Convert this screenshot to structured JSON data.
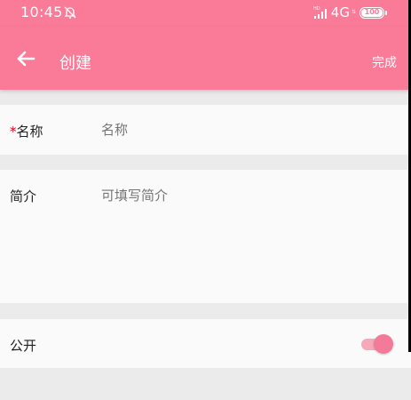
{
  "status_bar": {
    "time": "10:45",
    "network": "4G",
    "battery": "100"
  },
  "app_bar": {
    "title": "创建",
    "done_label": "完成"
  },
  "form": {
    "name": {
      "required_mark": "*",
      "label": "名称",
      "placeholder": "名称",
      "value": ""
    },
    "intro": {
      "label": "简介",
      "placeholder": "可填写简介",
      "value": ""
    },
    "public": {
      "label": "公开",
      "enabled": true
    }
  },
  "colors": {
    "brand": "#f97b98",
    "background": "#ebebeb",
    "section": "#fafafa",
    "required": "#d0021b"
  }
}
